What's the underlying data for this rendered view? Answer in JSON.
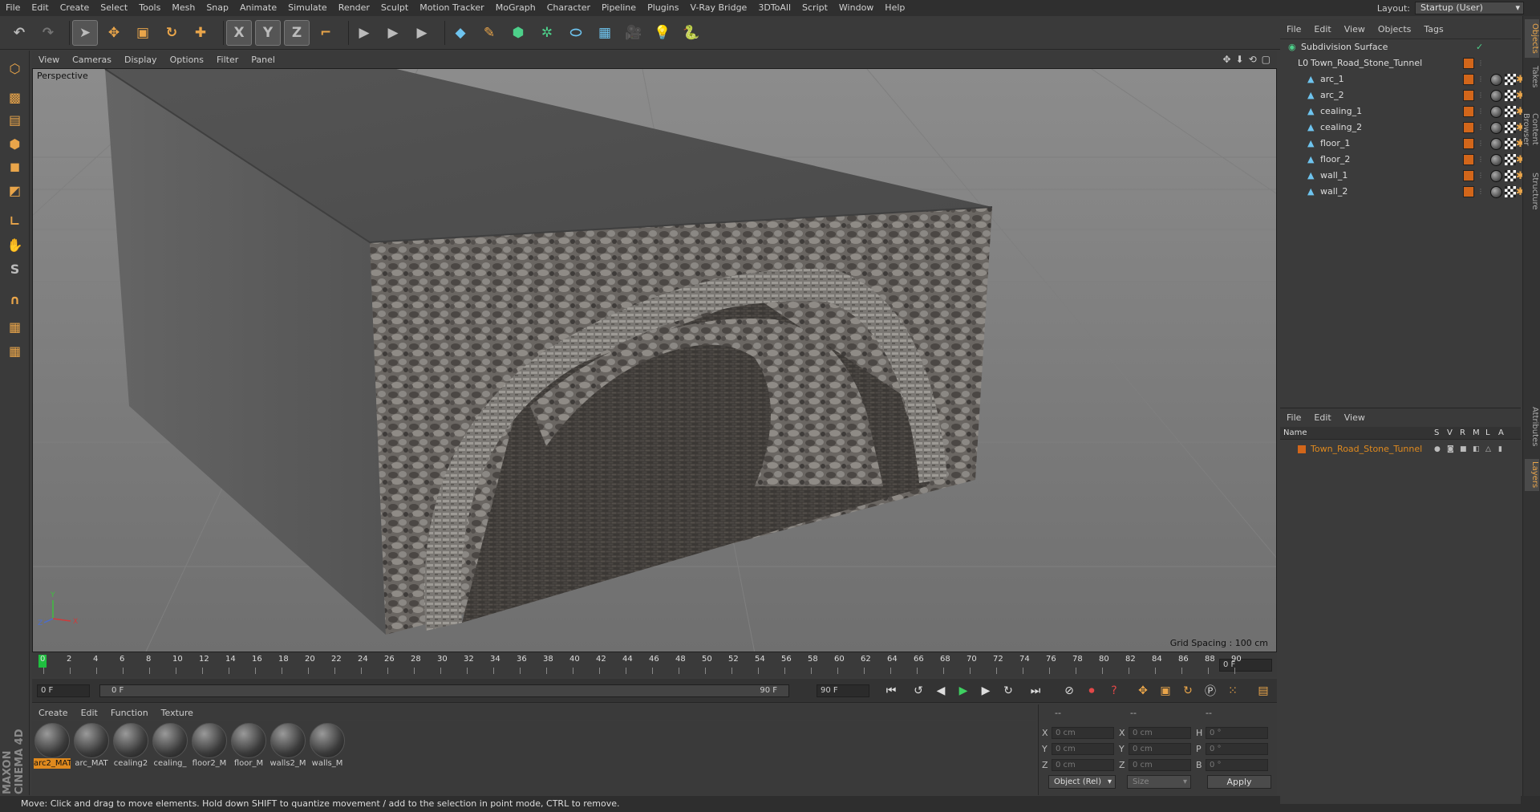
{
  "menu": [
    "File",
    "Edit",
    "Create",
    "Select",
    "Tools",
    "Mesh",
    "Snap",
    "Animate",
    "Simulate",
    "Render",
    "Sculpt",
    "Motion Tracker",
    "MoGraph",
    "Character",
    "Pipeline",
    "Plugins",
    "V-Ray Bridge",
    "3DToAll",
    "Script",
    "Window",
    "Help"
  ],
  "layout": {
    "label": "Layout:",
    "value": "Startup (User)"
  },
  "toolbar": {
    "undo": "↶",
    "redo": "↷",
    "select": "➤",
    "move": "✥",
    "scale": "▣",
    "rotate": "↻",
    "add": "✚",
    "x": "X",
    "y": "Y",
    "z": "Z",
    "coord": "⌐",
    "render1": "▶",
    "render2": "▶",
    "render3": "▶",
    "cube": "◆",
    "pen": "✎",
    "generator": "⬢",
    "deformer": "✲",
    "nurbs": "⬭",
    "floor": "▦",
    "camera": "🎥",
    "light": "💡",
    "python": "🐍"
  },
  "lefttools": [
    "⬡",
    "▩",
    "▤",
    "⬢",
    "◼",
    "◩",
    "∟",
    "✋",
    "S",
    "∩",
    "▦",
    "▦"
  ],
  "brand": "MAXON CINEMA 4D",
  "viewport": {
    "menu": [
      "View",
      "Cameras",
      "Display",
      "Options",
      "Filter",
      "Panel"
    ],
    "icons": [
      "✥",
      "⬇",
      "⟲",
      "▢"
    ],
    "label": "Perspective",
    "grid_spacing": "Grid Spacing : 100 cm",
    "axis": {
      "y": "Y",
      "x": "X",
      "z": "Z"
    }
  },
  "timeline": {
    "ticks": [
      "0",
      "2",
      "4",
      "6",
      "8",
      "10",
      "12",
      "14",
      "16",
      "18",
      "20",
      "22",
      "24",
      "26",
      "28",
      "30",
      "32",
      "34",
      "36",
      "38",
      "40",
      "42",
      "44",
      "46",
      "48",
      "50",
      "52",
      "54",
      "56",
      "58",
      "60",
      "62",
      "64",
      "66",
      "68",
      "70",
      "72",
      "74",
      "76",
      "78",
      "80",
      "82",
      "84",
      "86",
      "88",
      "90"
    ],
    "current_frame": "0 F"
  },
  "playbar": {
    "start": "0 F",
    "range_start": "0 F",
    "range_end": "90 F",
    "end": "90 F",
    "buttons": {
      "first": "⏮",
      "prev_key": "↺",
      "prev": "◀",
      "play": "▶",
      "next": "▶",
      "next_key": "↻",
      "last": "⏭"
    }
  },
  "materials_menu": [
    "Create",
    "Edit",
    "Function",
    "Texture"
  ],
  "materials": [
    "arc2_MAT",
    "arc_MAT",
    "cealing2",
    "cealing_",
    "floor2_M",
    "floor_M",
    "walls2_M",
    "walls_M"
  ],
  "coords": {
    "headers": [
      "--",
      "--",
      "--"
    ],
    "rows": [
      {
        "l1": "X",
        "v1": "0 cm",
        "l2": "X",
        "v2": "0 cm",
        "l3": "H",
        "v3": "0 °"
      },
      {
        "l1": "Y",
        "v1": "0 cm",
        "l2": "Y",
        "v2": "0 cm",
        "l3": "P",
        "v3": "0 °"
      },
      {
        "l1": "Z",
        "v1": "0 cm",
        "l2": "Z",
        "v2": "0 cm",
        "l3": "B",
        "v3": "0 °"
      }
    ],
    "mode": "Object (Rel)",
    "size": "Size",
    "apply": "Apply"
  },
  "status": "Move: Click and drag to move elements. Hold down SHIFT to quantize movement / add to the selection in point mode, CTRL to remove.",
  "objects": {
    "menu": [
      "File",
      "Edit",
      "View",
      "Objects",
      "Tags"
    ],
    "tree": [
      {
        "name": "Subdivision Surface",
        "indent": 0,
        "icon": "◉"
      },
      {
        "name": "Town_Road_Stone_Tunnel",
        "indent": 1,
        "icon": "L0"
      },
      {
        "name": "arc_1",
        "indent": 2,
        "icon": "▲"
      },
      {
        "name": "arc_2",
        "indent": 2,
        "icon": "▲"
      },
      {
        "name": "cealing_1",
        "indent": 2,
        "icon": "▲"
      },
      {
        "name": "cealing_2",
        "indent": 2,
        "icon": "▲"
      },
      {
        "name": "floor_1",
        "indent": 2,
        "icon": "▲"
      },
      {
        "name": "floor_2",
        "indent": 2,
        "icon": "▲"
      },
      {
        "name": "wall_1",
        "indent": 2,
        "icon": "▲"
      },
      {
        "name": "wall_2",
        "indent": 2,
        "icon": "▲"
      }
    ]
  },
  "layers": {
    "menu": [
      "File",
      "Edit",
      "View"
    ],
    "columns": {
      "name": "Name",
      "s": "S",
      "v": "V",
      "r": "R",
      "m": "M",
      "l": "L",
      "a": "A"
    },
    "items": [
      {
        "name": "Town_Road_Stone_Tunnel",
        "color": "#d2661a"
      }
    ]
  },
  "right_tabs": [
    "Objects",
    "Takes",
    "Content Browser",
    "Structure",
    "Attributes",
    "Layers"
  ],
  "colors": {
    "accent": "#e08a1e",
    "tag": "#d2661a"
  }
}
